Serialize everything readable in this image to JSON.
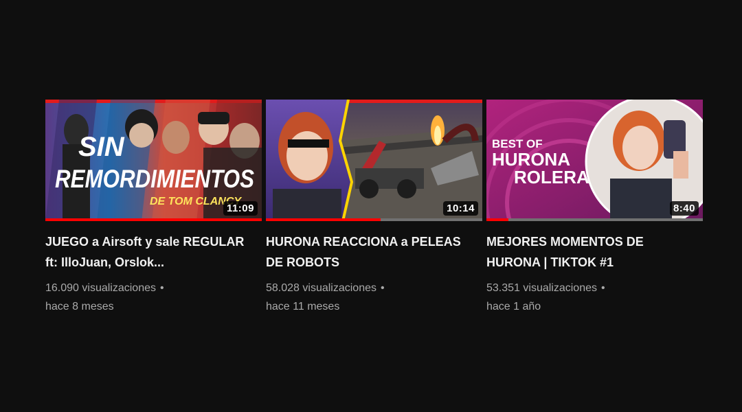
{
  "videos": [
    {
      "title": "JUEGO a Airsoft y sale REGULAR ft: IlloJuan, Orslok...",
      "thumbnail_text": [
        "SIN",
        "REMORDIMIENTOS",
        "DE TOM CLANCY"
      ],
      "duration": "11:09",
      "views": "16.090 visualizaciones",
      "separator": "•",
      "age": "hace 8 meses",
      "watched_fraction": 1.0
    },
    {
      "title": "HURONA REACCIONA a PELEAS DE ROBOTS",
      "thumbnail_text": [],
      "duration": "10:14",
      "views": "58.028 visualizaciones",
      "separator": "•",
      "age": "hace 11 meses",
      "watched_fraction": 0.53
    },
    {
      "title": "MEJORES MOMENTOS DE HURONA | TIKTOK #1",
      "thumbnail_text": [
        "BEST OF",
        "HURONA",
        "ROLERA"
      ],
      "duration": "8:40",
      "views": "53.351 visualizaciones",
      "separator": "•",
      "age": "hace 1 año",
      "watched_fraction": 0.1
    }
  ],
  "colors": {
    "background": "#0f0f0f",
    "progress": "#ff0000",
    "title": "#f1f1f1",
    "meta": "#aaaaaa"
  }
}
